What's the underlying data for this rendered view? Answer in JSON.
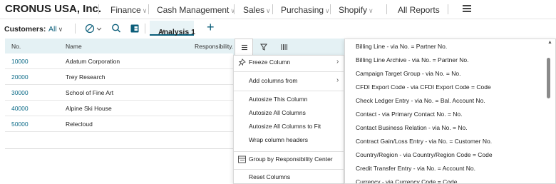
{
  "app": {
    "company": "CRONUS USA, Inc.",
    "nav": [
      {
        "label": "Finance",
        "has_menu": true
      },
      {
        "label": "Cash Management",
        "has_menu": true
      },
      {
        "label": "Sales",
        "has_menu": true
      },
      {
        "label": "Purchasing",
        "has_menu": true
      },
      {
        "label": "Shopify",
        "has_menu": true
      },
      {
        "label": "All Reports",
        "has_menu": false
      }
    ]
  },
  "filterbar": {
    "label": "Customers:",
    "view": "All",
    "analysis_tab": "Analysis 1",
    "icons": [
      "filter-pane-icon",
      "search-icon",
      "excel-icon",
      "add-icon"
    ]
  },
  "grid": {
    "columns": [
      "No.",
      "Name",
      "Responsibility..."
    ],
    "rows": [
      {
        "no": "10000",
        "name": "Adatum Corporation"
      },
      {
        "no": "20000",
        "name": "Trey Research"
      },
      {
        "no": "30000",
        "name": "School of Fine Art"
      },
      {
        "no": "40000",
        "name": "Alpine Ski House"
      },
      {
        "no": "50000",
        "name": "Relecloud"
      }
    ]
  },
  "column_menu": {
    "toolbar_icons": [
      "menu-icon",
      "filter-icon",
      "columns-icon"
    ],
    "items": [
      {
        "label": "Freeze Column",
        "icon": "pin-icon",
        "submenu": true
      },
      {
        "label": "Add columns from",
        "submenu": true
      },
      {
        "label": "Autosize This Column"
      },
      {
        "label": "Autosize All Columns"
      },
      {
        "label": "Autosize All Columns to Fit"
      },
      {
        "label": "Wrap column headers"
      },
      {
        "label": "Group by Responsibility Center",
        "icon": "group-icon"
      },
      {
        "label": "Reset Columns"
      }
    ]
  },
  "add_columns_submenu": {
    "items": [
      "Billing Line - via No. = Partner No.",
      "Billing Line Archive - via No. = Partner No.",
      "Campaign Target Group - via No. = No.",
      "CFDI Export Code - via CFDI Export Code = Code",
      "Check Ledger Entry - via No. = Bal. Account No.",
      "Contact - via Primary Contact No. = No.",
      "Contact Business Relation - via No. = No.",
      "Contract Gain/Loss Entry - via No. = Customer No.",
      "Country/Region - via Country/Region Code = Code",
      "Credit Transfer Entry - via No. = Account No.",
      "Currency - via Currency Code = Code"
    ]
  },
  "colors": {
    "accent": "#0b5e7a",
    "header_bg": "#e4f1f4",
    "link": "#0b6a87"
  }
}
